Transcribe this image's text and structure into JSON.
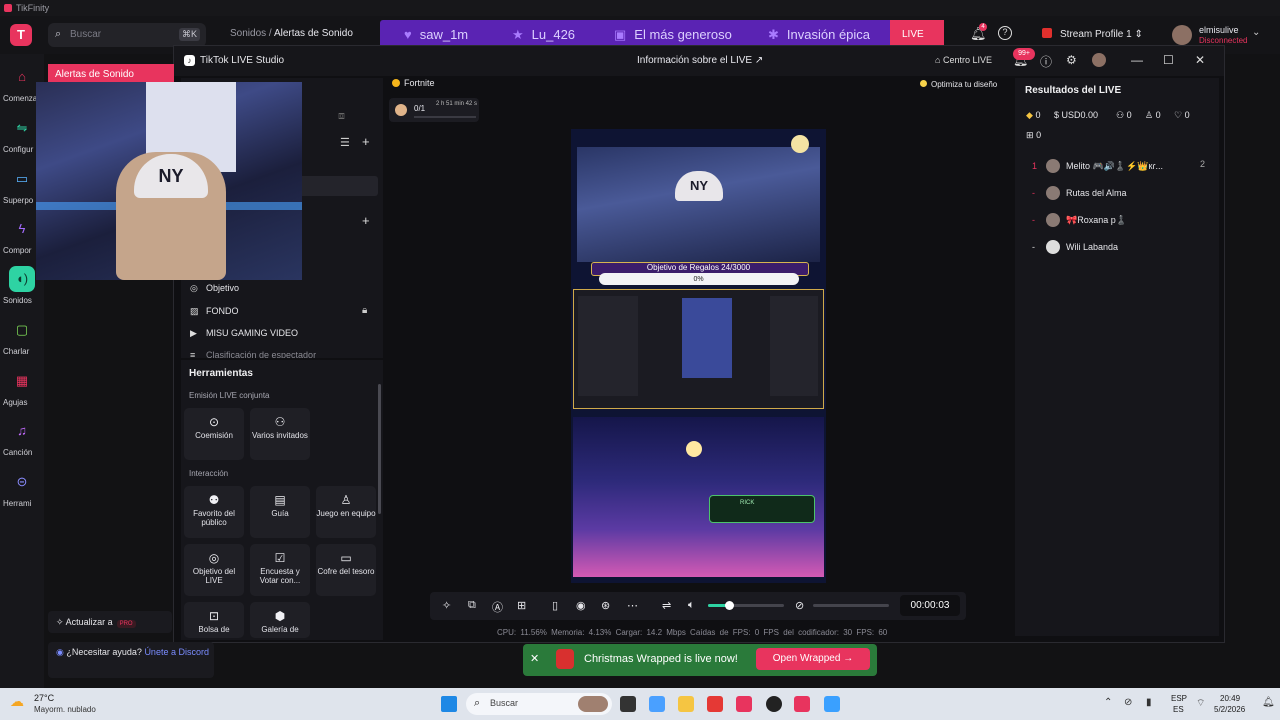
{
  "window_title": "TikFinity",
  "search": {
    "placeholder": "Buscar",
    "shortcut": "⌘K"
  },
  "breadcrumb": {
    "parent": "Sonidos",
    "sep": "/",
    "current": "Alertas de Sonido"
  },
  "banner": {
    "items": [
      "saw_1m",
      "Lu_426",
      "El más generoso",
      "Invasión épica"
    ],
    "live_label": "LIVE"
  },
  "topbar": {
    "bell_count": "4",
    "profile": "Stream Profile 1",
    "user_name": "elmisulive",
    "user_status": "Disconnected"
  },
  "sidebar": {
    "items": [
      {
        "label": "Comenza",
        "icon": "home-icon"
      },
      {
        "label": "Configur",
        "icon": "sliders-icon"
      },
      {
        "label": "Superpo",
        "icon": "monitor-icon"
      },
      {
        "label": "Compor",
        "icon": "bolt-icon"
      },
      {
        "label": "Sonidos",
        "icon": "sound-wave-icon"
      },
      {
        "label": "Charlar",
        "icon": "chat-icon"
      },
      {
        "label": "Agujas",
        "icon": "gift-icon"
      },
      {
        "label": "Canción",
        "icon": "music-icon"
      },
      {
        "label": "Herrami",
        "icon": "gamepad-icon"
      }
    ]
  },
  "overlay": {
    "title": "Alertas de Sonido",
    "hat_text": "NY"
  },
  "studio": {
    "title": "TikTok LIVE Studio",
    "header": "Información sobre el LIVE",
    "centro_live": "Centro LIVE",
    "notif_badge": "99+",
    "sources": [
      "Objetivo",
      "FONDO",
      "MISU GAMING VIDEO",
      "Clasificación de espectador"
    ],
    "tools_title": "Herramientas",
    "section_joint": "Emisión LIVE conjunta",
    "section_interaction": "Interacción",
    "tools_joint": [
      {
        "label": "Coemisión",
        "icon": "link-icon"
      },
      {
        "label": "Varios invitados",
        "icon": "users-icon"
      }
    ],
    "tools_interaction": [
      {
        "label": "Favorito del público",
        "icon": "star-user-icon"
      },
      {
        "label": "Guía",
        "icon": "book-icon"
      },
      {
        "label": "Juego en equipo",
        "icon": "team-icon"
      },
      {
        "label": "Objetivo del LIVE",
        "icon": "target-icon"
      },
      {
        "label": "Encuesta y Votar con...",
        "icon": "poll-icon"
      },
      {
        "label": "Cofre del tesoro",
        "icon": "chest-icon"
      },
      {
        "label": "Bolsa de",
        "icon": "bag-icon"
      },
      {
        "label": "Galería de",
        "icon": "gallery-icon"
      }
    ],
    "game_tag": "Fortnite",
    "goal_count": "0/1",
    "goal_time": "2 h 51 min 42 s",
    "optimize": "Optimiza tu diseño",
    "preview": {
      "goal_text": "Objetivo de Regalos 24/3000",
      "goal_pct": "0%",
      "hat_text": "NY",
      "card_name": "RICK"
    },
    "controls": {
      "timer": "00:00:03",
      "volume": 0.25
    },
    "stats": "CPU: 11.56%   Memoria: 4.13%   Cargar: 14.2 Mbps   Caídas de FPS: 0   FPS del codificador: 30   FPS: 60",
    "results": {
      "title": "Resultados del LIVE",
      "diamonds": "0",
      "usd": "USD0.00",
      "new_followers": "0",
      "viewers": "0",
      "likes": "0",
      "gifts": "0",
      "ranking": [
        {
          "rank": "1",
          "name": "Melito 🎮🔊♟️⚡👑кɾ...",
          "count": "2"
        },
        {
          "rank": "-",
          "name": "Rutas del Alma",
          "count": ""
        },
        {
          "rank": "-",
          "name": "🎀Roxana p♟️",
          "count": ""
        },
        {
          "rank": "-",
          "name": "Wili Labanda",
          "count": ""
        }
      ]
    }
  },
  "upgrade": {
    "label": "Actualizar a",
    "badge": "PRO"
  },
  "help": {
    "question": "¿Necesitar ayuda?",
    "link": "Únete a Discord"
  },
  "toast": {
    "text": "Christmas Wrapped is live now!",
    "button": "Open Wrapped"
  },
  "taskbar": {
    "weather_temp": "27°C",
    "weather_desc": "Mayorm. nublado",
    "search_placeholder": "Buscar",
    "lang1": "ESP",
    "lang2": "ES",
    "time": "20:49",
    "date": "5/2/2026"
  }
}
